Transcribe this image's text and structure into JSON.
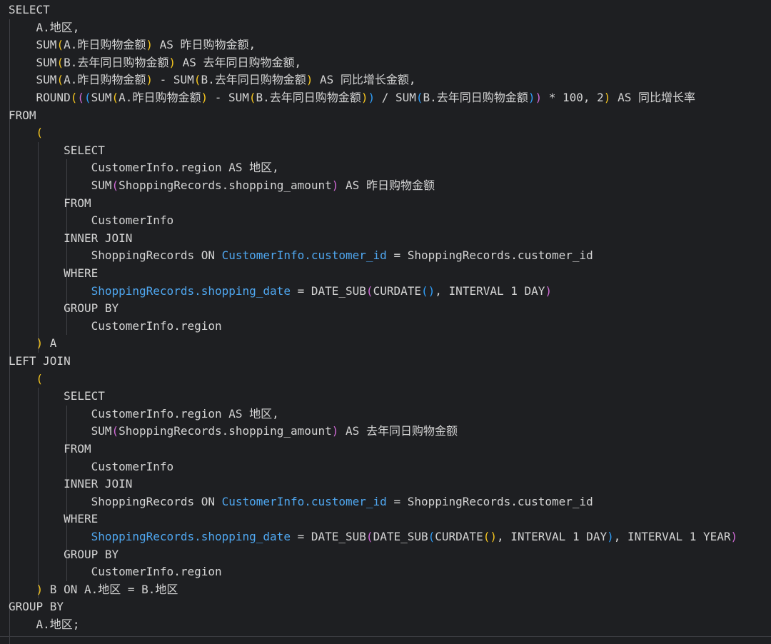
{
  "editor": {
    "lines": [
      {
        "tokens": [
          {
            "t": "SELECT",
            "c": "kw"
          }
        ]
      },
      {
        "tokens": [
          {
            "t": "    A.地区,",
            "c": "plain"
          }
        ]
      },
      {
        "tokens": [
          {
            "t": "    SUM",
            "c": "plain"
          },
          {
            "t": "(",
            "c": "p1"
          },
          {
            "t": "A.昨日购物金额",
            "c": "plain"
          },
          {
            "t": ")",
            "c": "p1"
          },
          {
            "t": " AS 昨日购物金额,",
            "c": "plain"
          }
        ]
      },
      {
        "tokens": [
          {
            "t": "    SUM",
            "c": "plain"
          },
          {
            "t": "(",
            "c": "p1"
          },
          {
            "t": "B.去年同日购物金额",
            "c": "plain"
          },
          {
            "t": ")",
            "c": "p1"
          },
          {
            "t": " AS 去年同日购物金额,",
            "c": "plain"
          }
        ]
      },
      {
        "tokens": [
          {
            "t": "    SUM",
            "c": "plain"
          },
          {
            "t": "(",
            "c": "p1"
          },
          {
            "t": "A.昨日购物金额",
            "c": "plain"
          },
          {
            "t": ")",
            "c": "p1"
          },
          {
            "t": " - SUM",
            "c": "plain"
          },
          {
            "t": "(",
            "c": "p1"
          },
          {
            "t": "B.去年同日购物金额",
            "c": "plain"
          },
          {
            "t": ")",
            "c": "p1"
          },
          {
            "t": " AS 同比增长金额,",
            "c": "plain"
          }
        ]
      },
      {
        "tokens": [
          {
            "t": "    ROUND",
            "c": "plain"
          },
          {
            "t": "(",
            "c": "p1"
          },
          {
            "t": "(",
            "c": "p2"
          },
          {
            "t": "(",
            "c": "p3"
          },
          {
            "t": "SUM",
            "c": "plain"
          },
          {
            "t": "(",
            "c": "p1"
          },
          {
            "t": "A.昨日购物金额",
            "c": "plain"
          },
          {
            "t": ")",
            "c": "p1"
          },
          {
            "t": " - SUM",
            "c": "plain"
          },
          {
            "t": "(",
            "c": "p1"
          },
          {
            "t": "B.去年同日购物金额",
            "c": "plain"
          },
          {
            "t": ")",
            "c": "p1"
          },
          {
            "t": ")",
            "c": "p3"
          },
          {
            "t": " / SUM",
            "c": "plain"
          },
          {
            "t": "(",
            "c": "p3"
          },
          {
            "t": "B.去年同日购物金额",
            "c": "plain"
          },
          {
            "t": ")",
            "c": "p3"
          },
          {
            "t": ")",
            "c": "p2"
          },
          {
            "t": " * 100, 2",
            "c": "plain"
          },
          {
            "t": ")",
            "c": "p1"
          },
          {
            "t": " AS 同比增长率",
            "c": "plain"
          }
        ]
      },
      {
        "tokens": [
          {
            "t": "FROM",
            "c": "kw"
          }
        ]
      },
      {
        "tokens": [
          {
            "t": "    ",
            "c": "plain"
          },
          {
            "t": "(",
            "c": "p1"
          }
        ]
      },
      {
        "tokens": [
          {
            "t": "        SELECT",
            "c": "kw"
          }
        ]
      },
      {
        "tokens": [
          {
            "t": "            CustomerInfo.region AS 地区,",
            "c": "plain"
          }
        ]
      },
      {
        "tokens": [
          {
            "t": "            SUM",
            "c": "plain"
          },
          {
            "t": "(",
            "c": "p2"
          },
          {
            "t": "ShoppingRecords.shopping_amount",
            "c": "plain"
          },
          {
            "t": ")",
            "c": "p2"
          },
          {
            "t": " AS 昨日购物金额",
            "c": "plain"
          }
        ]
      },
      {
        "tokens": [
          {
            "t": "        FROM",
            "c": "kw"
          }
        ]
      },
      {
        "tokens": [
          {
            "t": "            CustomerInfo",
            "c": "plain"
          }
        ]
      },
      {
        "tokens": [
          {
            "t": "        INNER JOIN",
            "c": "kw"
          }
        ]
      },
      {
        "tokens": [
          {
            "t": "            ShoppingRecords ON ",
            "c": "plain"
          },
          {
            "t": "CustomerInfo.customer_id",
            "c": "col"
          },
          {
            "t": " = ShoppingRecords.customer_id",
            "c": "plain"
          }
        ]
      },
      {
        "tokens": [
          {
            "t": "        WHERE",
            "c": "kw"
          }
        ]
      },
      {
        "tokens": [
          {
            "t": "            ",
            "c": "plain"
          },
          {
            "t": "ShoppingRecords.shopping_date",
            "c": "col"
          },
          {
            "t": " = DATE_SUB",
            "c": "plain"
          },
          {
            "t": "(",
            "c": "p2"
          },
          {
            "t": "CURDATE",
            "c": "plain"
          },
          {
            "t": "(",
            "c": "p3"
          },
          {
            "t": ")",
            "c": "p3"
          },
          {
            "t": ", INTERVAL 1 DAY",
            "c": "plain"
          },
          {
            "t": ")",
            "c": "p2"
          }
        ]
      },
      {
        "tokens": [
          {
            "t": "        GROUP BY",
            "c": "kw"
          }
        ]
      },
      {
        "tokens": [
          {
            "t": "            CustomerInfo.region",
            "c": "plain"
          }
        ]
      },
      {
        "tokens": [
          {
            "t": "    ",
            "c": "plain"
          },
          {
            "t": ")",
            "c": "p1"
          },
          {
            "t": " A",
            "c": "plain"
          }
        ]
      },
      {
        "tokens": [
          {
            "t": "LEFT JOIN",
            "c": "kw"
          }
        ]
      },
      {
        "tokens": [
          {
            "t": "    ",
            "c": "plain"
          },
          {
            "t": "(",
            "c": "p1"
          }
        ]
      },
      {
        "tokens": [
          {
            "t": "        SELECT",
            "c": "kw"
          }
        ]
      },
      {
        "tokens": [
          {
            "t": "            CustomerInfo.region AS 地区,",
            "c": "plain"
          }
        ]
      },
      {
        "tokens": [
          {
            "t": "            SUM",
            "c": "plain"
          },
          {
            "t": "(",
            "c": "p2"
          },
          {
            "t": "ShoppingRecords.shopping_amount",
            "c": "plain"
          },
          {
            "t": ")",
            "c": "p2"
          },
          {
            "t": " AS 去年同日购物金额",
            "c": "plain"
          }
        ]
      },
      {
        "tokens": [
          {
            "t": "        FROM",
            "c": "kw"
          }
        ]
      },
      {
        "tokens": [
          {
            "t": "            CustomerInfo",
            "c": "plain"
          }
        ]
      },
      {
        "tokens": [
          {
            "t": "        INNER JOIN",
            "c": "kw"
          }
        ]
      },
      {
        "tokens": [
          {
            "t": "            ShoppingRecords ON ",
            "c": "plain"
          },
          {
            "t": "CustomerInfo.customer_id",
            "c": "col"
          },
          {
            "t": " = ShoppingRecords.customer_id",
            "c": "plain"
          }
        ]
      },
      {
        "tokens": [
          {
            "t": "        WHERE",
            "c": "kw"
          }
        ]
      },
      {
        "tokens": [
          {
            "t": "            ",
            "c": "plain"
          },
          {
            "t": "ShoppingRecords.shopping_date",
            "c": "col"
          },
          {
            "t": " = DATE_SUB",
            "c": "plain"
          },
          {
            "t": "(",
            "c": "p2"
          },
          {
            "t": "DATE_SUB",
            "c": "plain"
          },
          {
            "t": "(",
            "c": "p3"
          },
          {
            "t": "CURDATE",
            "c": "plain"
          },
          {
            "t": "(",
            "c": "p1"
          },
          {
            "t": ")",
            "c": "p1"
          },
          {
            "t": ", INTERVAL 1 DAY",
            "c": "plain"
          },
          {
            "t": ")",
            "c": "p3"
          },
          {
            "t": ", INTERVAL 1 YEAR",
            "c": "plain"
          },
          {
            "t": ")",
            "c": "p2"
          }
        ]
      },
      {
        "tokens": [
          {
            "t": "        GROUP BY",
            "c": "kw"
          }
        ]
      },
      {
        "tokens": [
          {
            "t": "            CustomerInfo.region",
            "c": "plain"
          }
        ]
      },
      {
        "tokens": [
          {
            "t": "    ",
            "c": "plain"
          },
          {
            "t": ")",
            "c": "p1"
          },
          {
            "t": " B ON A.地区 = B.地区",
            "c": "plain"
          }
        ]
      },
      {
        "tokens": [
          {
            "t": "GROUP BY",
            "c": "kw"
          }
        ]
      },
      {
        "tokens": [
          {
            "t": "    A.地区",
            "c": "plain"
          },
          {
            "t": ";",
            "c": "semi"
          }
        ]
      }
    ]
  }
}
